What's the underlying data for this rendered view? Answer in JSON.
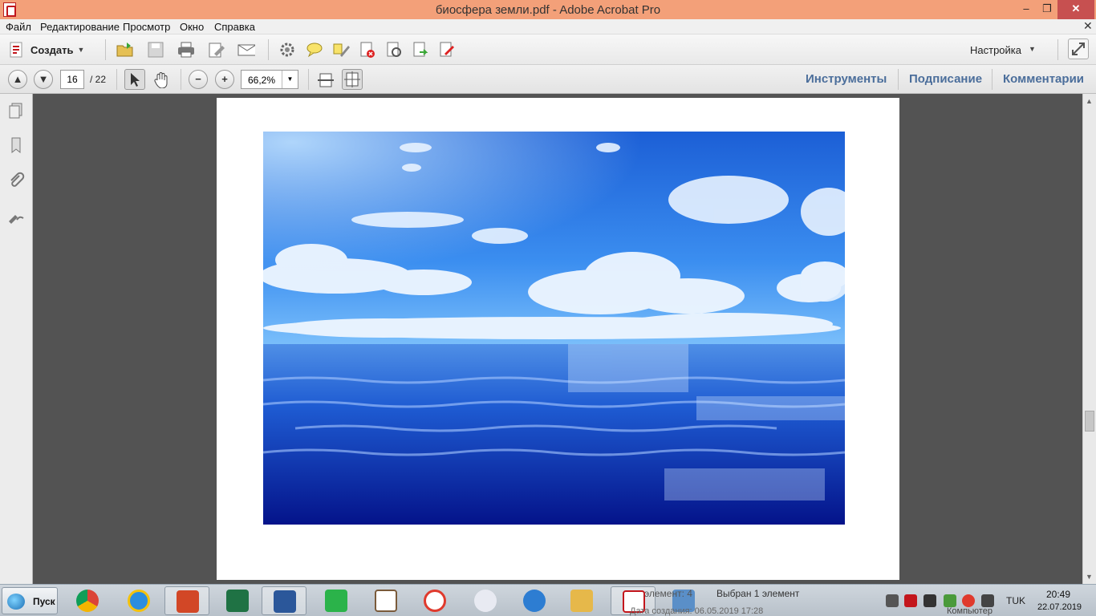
{
  "window": {
    "title": "биосфера земли.pdf - Adobe Acrobat Pro",
    "min_glyph": "–",
    "max_glyph": "❐",
    "close_glyph": "✕"
  },
  "menu": {
    "items": [
      "Файл",
      "Редактирование",
      "Просмотр",
      "Окно",
      "Справка"
    ],
    "doc_close_glyph": "✕"
  },
  "toolbar": {
    "create_label": "Создать",
    "settings_label": "Настройка",
    "dropdown_glyph": "▼",
    "icons": [
      "open-folder-icon",
      "save-icon",
      "print-icon",
      "edit-icon",
      "email-icon",
      "gear-icon",
      "comment-bubble-icon",
      "highlighter-icon",
      "delete-pages-icon",
      "extract-icon",
      "export-icon",
      "sign-icon"
    ]
  },
  "navigation": {
    "current_page": "16",
    "page_total": "/ 22",
    "zoom_value": "66,2%",
    "prev_glyph": "▲",
    "next_glyph": "▼",
    "zoom_out_glyph": "−",
    "zoom_in_glyph": "+"
  },
  "panels": {
    "tools": "Инструменты",
    "sign": "Подписание",
    "comments": "Комментарии"
  },
  "leftnav": {
    "icons": [
      "pages-icon",
      "bookmark-icon",
      "attachment-icon",
      "signature-icon"
    ]
  },
  "document": {
    "image": "ocean-sky-photo"
  },
  "scrollbar": {
    "up_glyph": "▲",
    "down_glyph": "▼"
  },
  "taskbar": {
    "start_label": "Пуск",
    "ghost_item": "элемент: 4",
    "ghost_selected": "Выбран 1 элемент",
    "ghost_date": "Дата создания: 06.05.2019 17:28",
    "ghost_computer": "Компьютер",
    "apps": [
      {
        "name": "chrome",
        "color": "#db4437"
      },
      {
        "name": "internet-explorer",
        "color": "#2b8ddf"
      },
      {
        "name": "powerpoint",
        "color": "#d24726"
      },
      {
        "name": "excel",
        "color": "#1f7244"
      },
      {
        "name": "word",
        "color": "#2b579a"
      },
      {
        "name": "store",
        "color": "#2bb34a"
      },
      {
        "name": "calendar-321",
        "color": "#7a5a3a"
      },
      {
        "name": "yandex",
        "color": "#e03a2d"
      },
      {
        "name": "scissors",
        "color": "#9b9fb3"
      },
      {
        "name": "mail",
        "color": "#2d7dd2"
      },
      {
        "name": "file-explorer",
        "color": "#e6b84a"
      },
      {
        "name": "acrobat",
        "color": "#c3161c"
      },
      {
        "name": "photo-viewer",
        "color": "#5a8fc8"
      }
    ],
    "language": "TUK",
    "time": "20:49",
    "date": "22.07.2019"
  }
}
